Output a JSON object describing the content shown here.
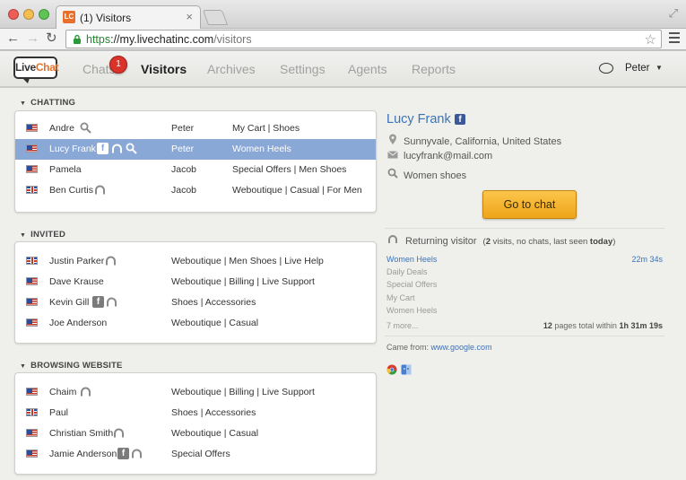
{
  "browser": {
    "tab_title": "(1) Visitors",
    "tab_favicon": "LC",
    "url_scheme": "https",
    "url_sep": "://",
    "url_host": "my.livechatinc.com",
    "url_path": "/visitors"
  },
  "app": {
    "logo_live": "Live",
    "logo_chat": "Chat",
    "nav": [
      "Chats",
      "Visitors",
      "Archives",
      "Settings",
      "Agents",
      "Reports"
    ],
    "active_nav": "Visitors",
    "chats_badge": "1",
    "agent_name": "Peter"
  },
  "sections": {
    "chatting": {
      "title": "CHATTING",
      "rows": [
        {
          "name": "Andre",
          "flag": "us",
          "icons": [
            "search-icon"
          ],
          "agent": "Peter",
          "pages": "My Cart | Shoes"
        },
        {
          "name": "Lucy Frank",
          "flag": "us",
          "icons": [
            "facebook-icon",
            "headset-icon",
            "search-icon"
          ],
          "agent": "Peter",
          "pages": "Women Heels",
          "selected": true
        },
        {
          "name": "Pamela",
          "flag": "us",
          "icons": [],
          "agent": "Jacob",
          "pages": "Special Offers | Men Shoes"
        },
        {
          "name": "Ben Curtis",
          "flag": "uk",
          "icons": [
            "headset-icon"
          ],
          "agent": "Jacob",
          "pages": "Weboutique | Casual | For Men"
        }
      ]
    },
    "invited": {
      "title": "INVITED",
      "rows": [
        {
          "name": "Justin Parker",
          "flag": "uk",
          "icons": [
            "headset-icon"
          ],
          "pages": "Weboutique | Men Shoes | Live Help"
        },
        {
          "name": "Dave Krause",
          "flag": "us",
          "icons": [],
          "pages": "Weboutique | Billing | Live Support"
        },
        {
          "name": "Kevin Gill",
          "flag": "us",
          "icons": [
            "facebook-icon",
            "headset-icon"
          ],
          "pages": "Shoes | Accessories"
        },
        {
          "name": "Joe Anderson",
          "flag": "us",
          "icons": [],
          "pages": "Weboutique | Casual"
        }
      ]
    },
    "browsing": {
      "title": "BROWSING WEBSITE",
      "rows": [
        {
          "name": "Chaim",
          "flag": "us",
          "icons": [
            "headset-icon"
          ],
          "pages": "Weboutique | Billing | Live Support"
        },
        {
          "name": "Paul",
          "flag": "uk",
          "icons": [],
          "pages": "Shoes | Accessories"
        },
        {
          "name": "Christian Smith",
          "flag": "us",
          "icons": [
            "headset-icon"
          ],
          "pages": "Weboutique | Casual"
        },
        {
          "name": "Jamie Anderson",
          "flag": "us",
          "icons": [
            "facebook-icon",
            "headset-icon"
          ],
          "pages": "Special Offers"
        }
      ]
    }
  },
  "details": {
    "name": "Lucy Frank",
    "location": "Sunnyvale, California, United States",
    "email": "lucyfrank@mail.com",
    "search": "Women shoes",
    "go_to_chat": "Go to chat",
    "returning_label": "Returning visitor",
    "returning_stats_open": "(",
    "returning_visits": "2",
    "returning_visits_label": "visits, no chats, last seen",
    "returning_last_seen": "today",
    "returning_stats_close": ")",
    "history": [
      "Women Heels",
      "Daily Deals",
      "Special Offers",
      "My Cart",
      "Women Heels"
    ],
    "history_time": "22m 34s",
    "more": "7 more...",
    "total_pages": "12",
    "total_label": "pages total within",
    "total_time": "1h 31m 19s",
    "came_from_label": "Came from:",
    "came_from_link": "www.google.com",
    "browser_icons": [
      "chrome-icon",
      "mac-os-icon"
    ]
  },
  "colors": {
    "accent_blue": "#3b73b9",
    "selected_row": "#8aa8d6",
    "button_orange": "#f4b22f",
    "badge_red": "#d9332a"
  }
}
